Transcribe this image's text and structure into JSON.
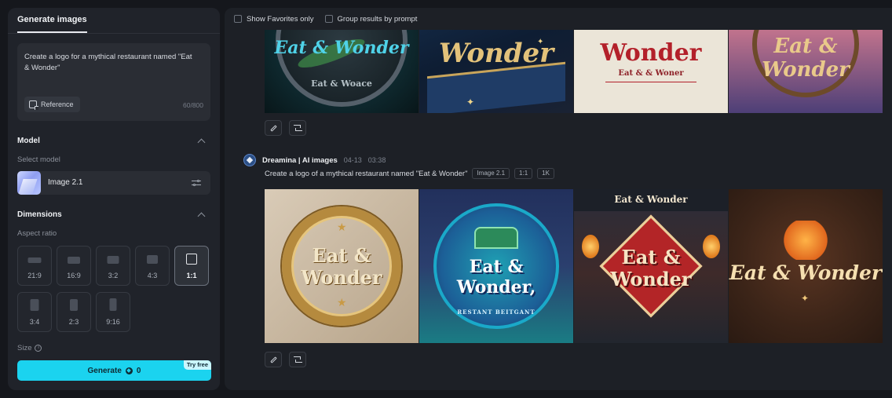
{
  "left_panel": {
    "tab_label": "Generate images",
    "prompt": {
      "text": "Create a logo for a mythical restaurant named \"Eat & Wonder\"",
      "reference_label": "Reference",
      "counter": "60/800"
    },
    "model_section": {
      "title": "Model",
      "select_label": "Select model",
      "selected_model": "Image 2.1"
    },
    "dimensions_section": {
      "title": "Dimensions",
      "aspect_label": "Aspect ratio",
      "ratios": [
        {
          "label": "21:9",
          "active": false
        },
        {
          "label": "16:9",
          "active": false
        },
        {
          "label": "3:2",
          "active": false
        },
        {
          "label": "4:3",
          "active": false
        },
        {
          "label": "1:1",
          "active": true
        },
        {
          "label": "3:4",
          "active": false
        },
        {
          "label": "2:3",
          "active": false
        },
        {
          "label": "9:16",
          "active": false
        }
      ],
      "size_label": "Size"
    },
    "generate": {
      "label": "Generate",
      "cost": "0",
      "badge": "Try free"
    }
  },
  "right_panel": {
    "filters": {
      "favorites_label": "Show Favorites only",
      "group_label": "Group results by prompt"
    },
    "generation_1": {
      "tiles": [
        {
          "title": "Eat & Wonder",
          "subtitle": "Eat & Woace"
        },
        {
          "title": "Wonder",
          "subtitle": ""
        },
        {
          "title": "Wonder",
          "subtitle": "Eat & & Woner"
        },
        {
          "title": "Eat & Wonder",
          "subtitle": ""
        }
      ]
    },
    "generation_2": {
      "brand": "Dreamina | AI images",
      "date": "04-13",
      "time": "03:38",
      "prompt": "Create a logo of a mythical restaurant named \"Eat & Wonder\"",
      "tags": [
        "Image 2.1",
        "1:1",
        "1K"
      ],
      "tiles": [
        {
          "title_1": "Eat &",
          "title_2": "Wonder",
          "subtitle": ""
        },
        {
          "title_1": "Eat &",
          "title_2": "Wonder,",
          "subtitle": "RESTANT BEITGANT"
        },
        {
          "banner": "Eat & Wonder",
          "title_1": "Eat &",
          "title_2": "Wonder",
          "subtitle": ""
        },
        {
          "title_1": "Eat & Wonder",
          "title_2": "",
          "subtitle": ""
        }
      ]
    }
  }
}
